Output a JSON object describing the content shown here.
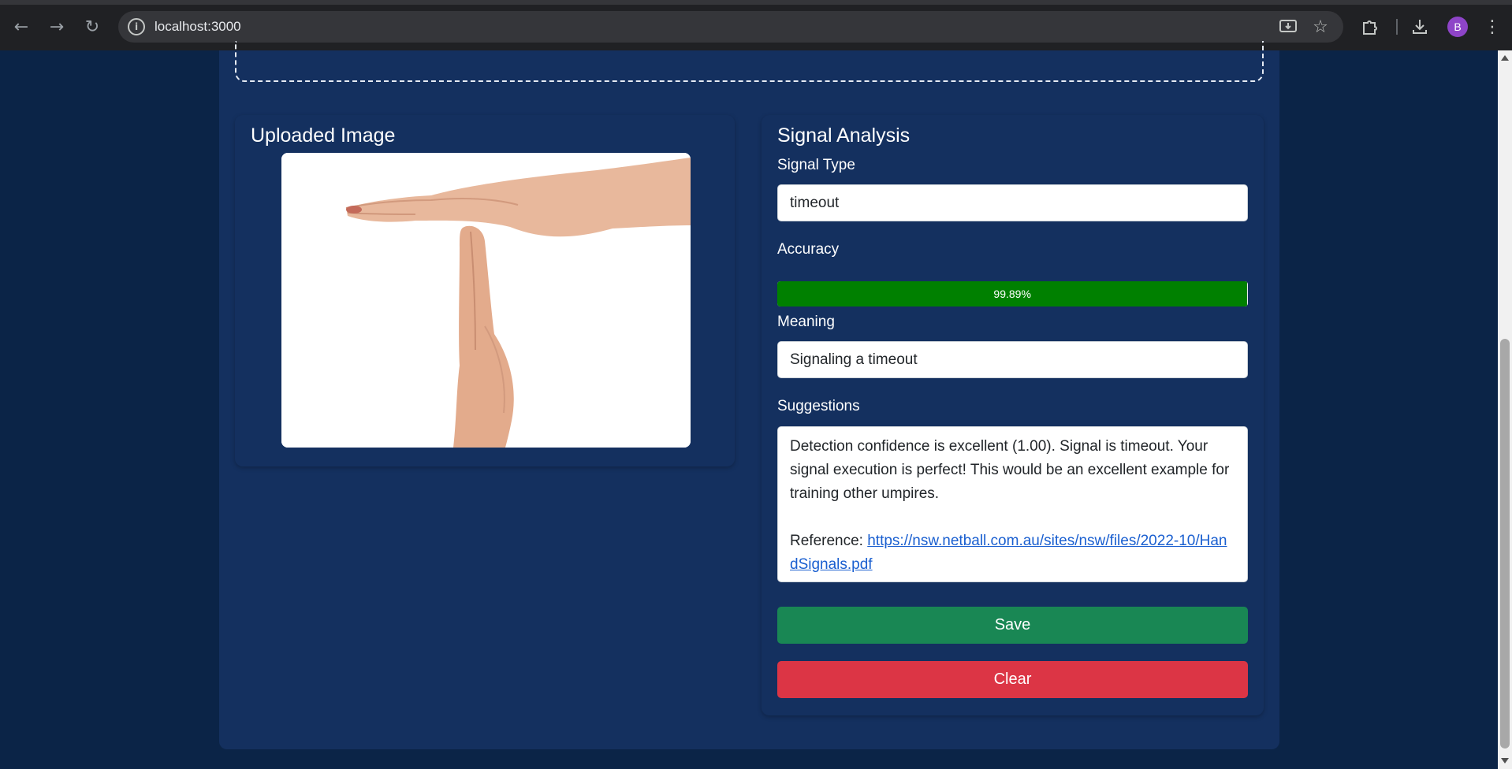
{
  "browser": {
    "url": "localhost:3000",
    "avatar_initial": "B",
    "icons": [
      "back-icon",
      "forward-icon",
      "reload-icon",
      "site-info-icon",
      "install-app-icon",
      "bookmark-star-icon",
      "extensions-icon",
      "downloads-icon",
      "menu-icon"
    ]
  },
  "uploaded": {
    "title": "Uploaded Image"
  },
  "analysis": {
    "title": "Signal Analysis",
    "signal_type_label": "Signal Type",
    "signal_type_value": "timeout",
    "accuracy_label": "Accuracy",
    "accuracy_text": "99.89%",
    "accuracy_value": 99.89,
    "meaning_label": "Meaning",
    "meaning_value": "Signaling a timeout",
    "suggestions_label": "Suggestions",
    "suggestions_text": "Detection confidence is excellent (1.00). Signal is timeout. Your signal execution is perfect! This would be an excellent example for training other umpires.",
    "reference_label": "Reference:",
    "reference_url": "https://nsw.netball.com.au/sites/nsw/files/2022-10/HandSignals.pdf"
  },
  "buttons": {
    "save": "Save",
    "clear": "Clear"
  },
  "colors": {
    "page_bg": "#0b2447",
    "panel_bg": "#14305f",
    "progress": "#008000",
    "save": "#198754",
    "clear": "#dc3545",
    "link": "#1a5fd0"
  }
}
